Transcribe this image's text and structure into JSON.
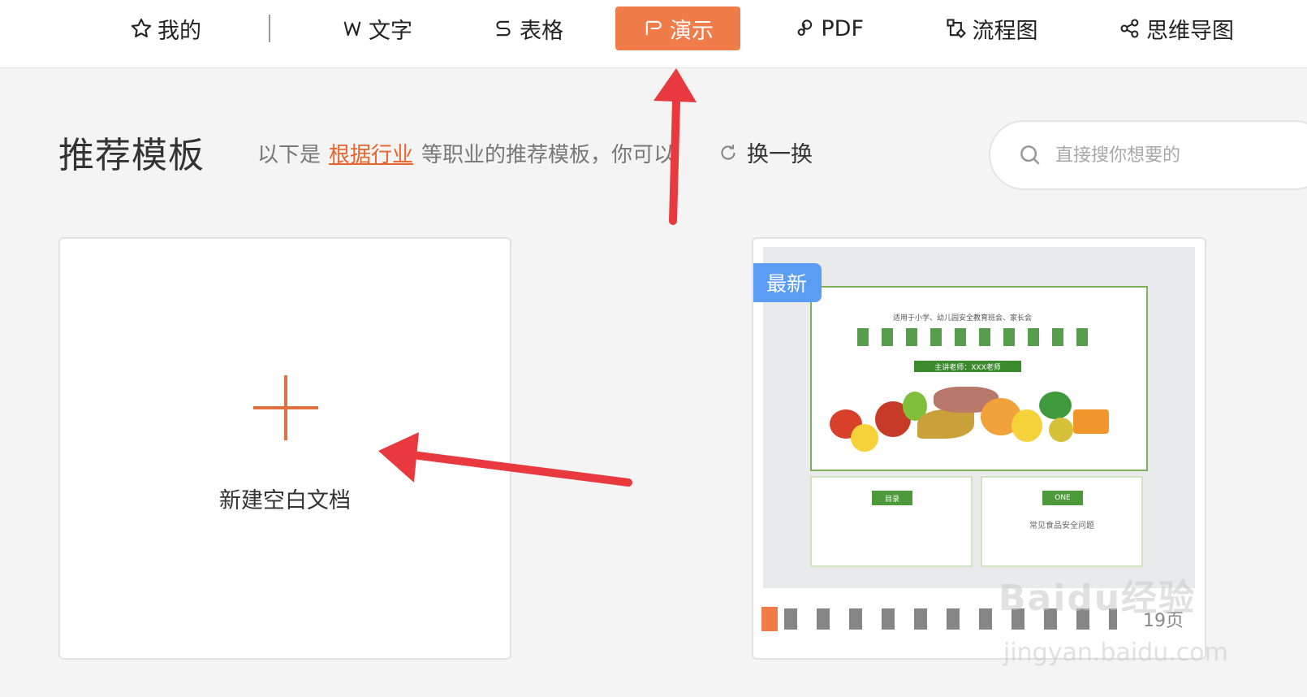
{
  "nav": {
    "items": [
      {
        "label": "我的",
        "icon": "star-icon"
      },
      {
        "label": "文字",
        "icon": "word-icon"
      },
      {
        "label": "表格",
        "icon": "sheet-icon"
      },
      {
        "label": "演示",
        "icon": "presentation-icon",
        "active": true
      },
      {
        "label": "PDF",
        "icon": "pdf-icon"
      },
      {
        "label": "流程图",
        "icon": "flowchart-icon"
      },
      {
        "label": "思维导图",
        "icon": "mindmap-icon"
      }
    ],
    "active_color": "#f07c4a"
  },
  "section": {
    "title": "推荐模板",
    "hint_prefix": "以下是",
    "hint_link": "根据行业",
    "hint_suffix": "等职业的推荐模板，你可以",
    "refresh_label": "换一换"
  },
  "search": {
    "placeholder": "直接搜你想要的"
  },
  "new_doc": {
    "label": "新建空白文档"
  },
  "template": {
    "badge": "最新",
    "pages": "19页",
    "slide_small": "适用于小学、幼儿园安全教育班会、家长会",
    "slide_speaker": "主讲老师：XXX老师",
    "sub1_tag": "目录",
    "sub2_tag": "ONE",
    "sub2_text": "常见食品安全问题"
  },
  "watermark": {
    "line1": "Baidu经验",
    "line2": "jingyan.baidu.com"
  },
  "colors": {
    "accent": "#f07c4a",
    "link": "#e8632d",
    "badge": "#5b9df5",
    "arrow": "#e8393f"
  }
}
